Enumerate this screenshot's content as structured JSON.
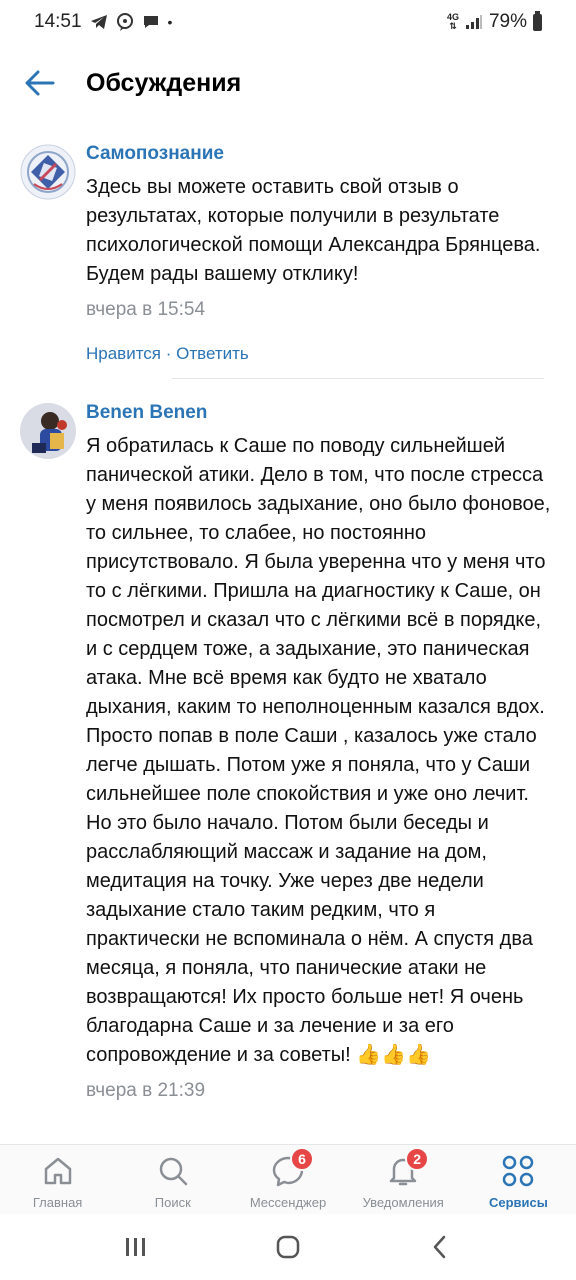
{
  "status_bar": {
    "time": "14:51",
    "network": "4G",
    "battery": "79%"
  },
  "header": {
    "title": "Обсуждения",
    "back_icon": "arrow-left-icon"
  },
  "comments": [
    {
      "author": "Самопознание",
      "text": "Здесь вы можете оставить свой отзыв о результатах, которые получили в результате психологической помощи Александра Брянцева. Будем рады вашему отклику!",
      "time": "вчера в 15:54",
      "like_label": "Нравится",
      "separator": " · ",
      "reply_label": "Ответить"
    },
    {
      "author": "Benen Benen",
      "text": "Я обратилась к Саше по поводу сильнейшей панической атики. Дело в том, что после стресса у меня появилось задыхание, оно было фоновое, то сильнее, то слабее, но постоянно присутствовало. Я была уверенна что у меня что то с лёгкими. Пришла на диагностику к Саше, он посмотрел и сказал что с лёгкими всё в порядке, и с сердцем тоже, а задыхание, это паническая атака. Мне всё время как будто не хватало дыхания, каким то неполноценным казался вдох. Просто попав в поле Саши , казалось уже стало легче дышать. Потом уже я поняла, что у Саши сильнейшее поле спокойствия и уже оно лечит. Но это было начало. Потом были беседы и расслабляющий массаж и задание на дом, медитация на точку. Уже через две недели задыхание стало таким редким, что я практически не вспоминала о нём. А спустя два месяца, я поняла, что панические атаки не возвращаются! Их просто больше нет! Я очень благодарна Саше и за лечение и за его сопровождение и за советы! 👍👍👍",
      "time": "вчера в 21:39"
    }
  ],
  "bottom_nav": [
    {
      "label": "Главная",
      "icon": "home-icon",
      "badge": ""
    },
    {
      "label": "Поиск",
      "icon": "search-icon",
      "badge": ""
    },
    {
      "label": "Мессенджер",
      "icon": "messenger-icon",
      "badge": "6"
    },
    {
      "label": "Уведомления",
      "icon": "bell-icon",
      "badge": "2"
    },
    {
      "label": "Сервисы",
      "icon": "services-icon",
      "badge": ""
    }
  ],
  "colors": {
    "accent": "#2b74b6",
    "badge": "#e64646",
    "muted": "#8a8f95"
  }
}
